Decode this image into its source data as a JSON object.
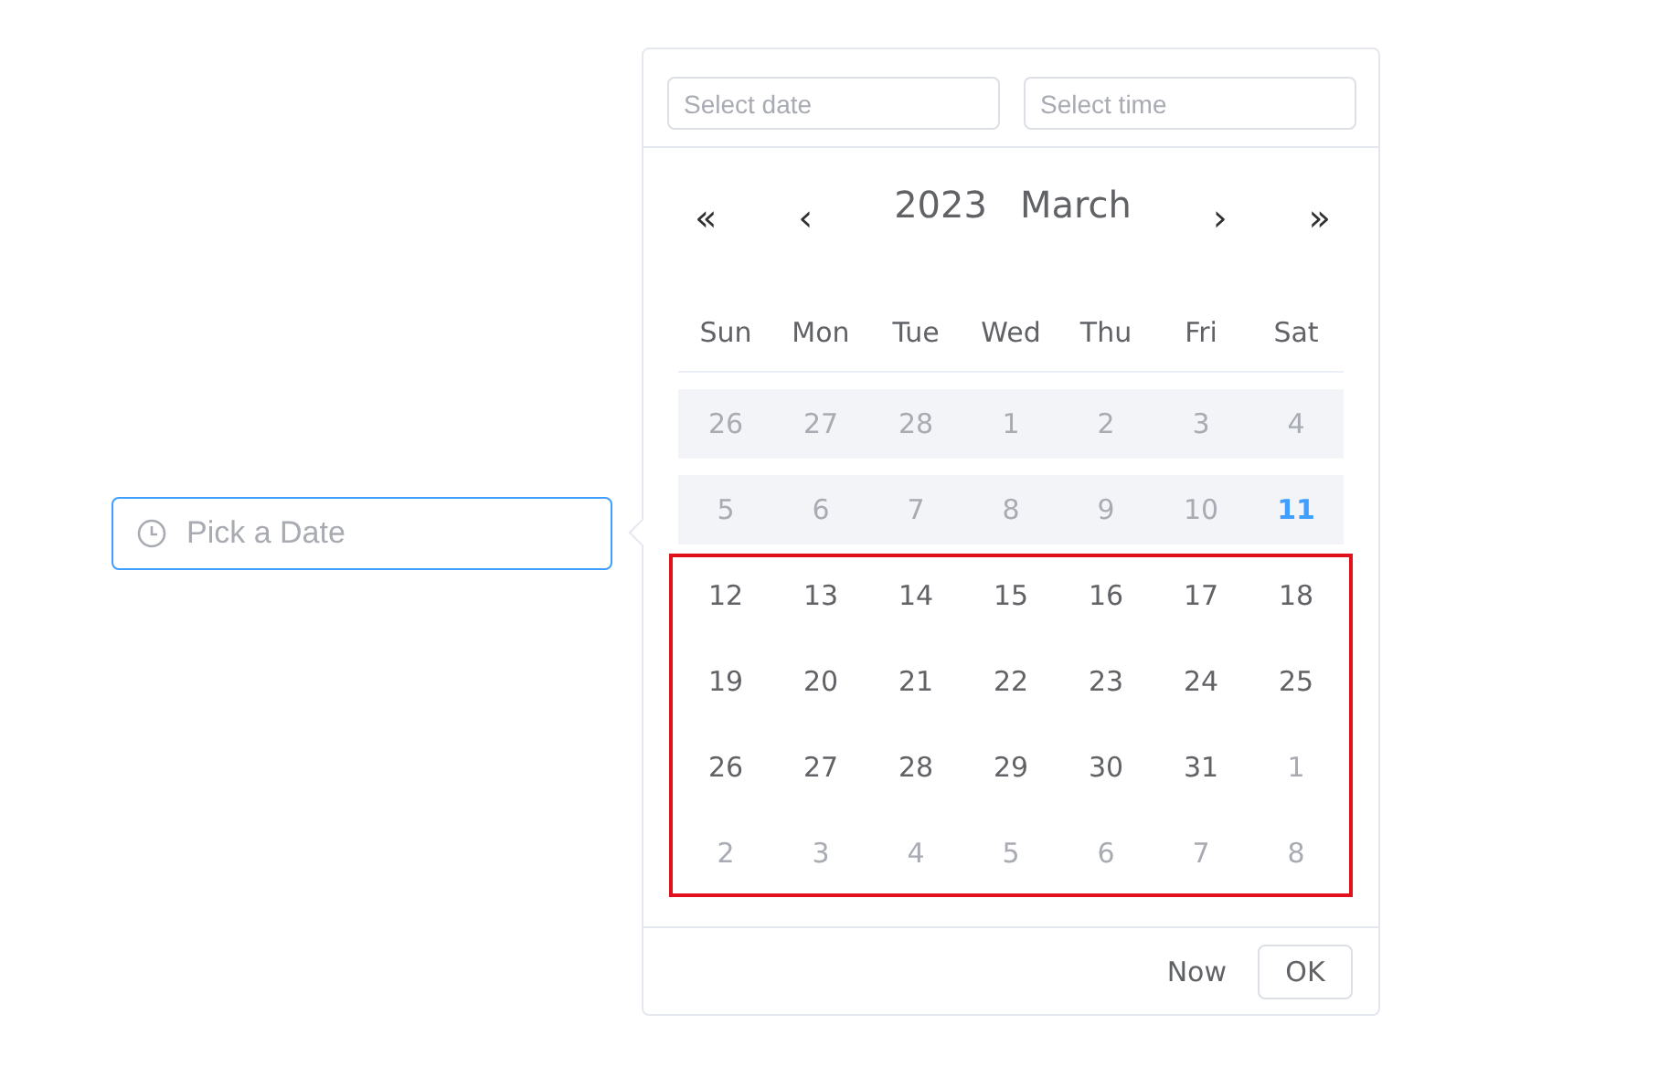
{
  "date_input": {
    "placeholder": "Pick a Date",
    "focused": true
  },
  "picker": {
    "date_field": {
      "placeholder": "Select date"
    },
    "time_field": {
      "placeholder": "Select time"
    },
    "prev_year": "«",
    "prev_month": "‹",
    "year": "2023",
    "month": "March",
    "next_month": "›",
    "next_year": "»",
    "weekdays": [
      "Sun",
      "Mon",
      "Tue",
      "Wed",
      "Thu",
      "Fri",
      "Sat"
    ],
    "weeks": [
      {
        "highlighted": false,
        "days": [
          {
            "label": "26",
            "kind": "muted",
            "disabled": true
          },
          {
            "label": "27",
            "kind": "muted",
            "disabled": true
          },
          {
            "label": "28",
            "kind": "muted",
            "disabled": true
          },
          {
            "label": "1",
            "kind": "current",
            "disabled": true
          },
          {
            "label": "2",
            "kind": "current",
            "disabled": true
          },
          {
            "label": "3",
            "kind": "current",
            "disabled": true
          },
          {
            "label": "4",
            "kind": "current",
            "disabled": true
          }
        ]
      },
      {
        "highlighted": false,
        "days": [
          {
            "label": "5",
            "kind": "current",
            "disabled": true
          },
          {
            "label": "6",
            "kind": "current",
            "disabled": true
          },
          {
            "label": "7",
            "kind": "current",
            "disabled": true
          },
          {
            "label": "8",
            "kind": "current",
            "disabled": true
          },
          {
            "label": "9",
            "kind": "current",
            "disabled": true
          },
          {
            "label": "10",
            "kind": "current",
            "disabled": true
          },
          {
            "label": "11",
            "kind": "today",
            "disabled": true
          }
        ]
      },
      {
        "highlighted": true,
        "days": [
          {
            "label": "12",
            "kind": "current",
            "disabled": false
          },
          {
            "label": "13",
            "kind": "current",
            "disabled": false
          },
          {
            "label": "14",
            "kind": "current",
            "disabled": false
          },
          {
            "label": "15",
            "kind": "current",
            "disabled": false
          },
          {
            "label": "16",
            "kind": "current",
            "disabled": false
          },
          {
            "label": "17",
            "kind": "current",
            "disabled": false
          },
          {
            "label": "18",
            "kind": "current",
            "disabled": false
          }
        ]
      },
      {
        "highlighted": true,
        "days": [
          {
            "label": "19",
            "kind": "current",
            "disabled": false
          },
          {
            "label": "20",
            "kind": "current",
            "disabled": false
          },
          {
            "label": "21",
            "kind": "current",
            "disabled": false
          },
          {
            "label": "22",
            "kind": "current",
            "disabled": false
          },
          {
            "label": "23",
            "kind": "current",
            "disabled": false
          },
          {
            "label": "24",
            "kind": "current",
            "disabled": false
          },
          {
            "label": "25",
            "kind": "current",
            "disabled": false
          }
        ]
      },
      {
        "highlighted": true,
        "days": [
          {
            "label": "26",
            "kind": "current",
            "disabled": false
          },
          {
            "label": "27",
            "kind": "current",
            "disabled": false
          },
          {
            "label": "28",
            "kind": "current",
            "disabled": false
          },
          {
            "label": "29",
            "kind": "current",
            "disabled": false
          },
          {
            "label": "30",
            "kind": "current",
            "disabled": false
          },
          {
            "label": "31",
            "kind": "current",
            "disabled": false
          },
          {
            "label": "1",
            "kind": "muted",
            "disabled": false
          }
        ]
      },
      {
        "highlighted": true,
        "days": [
          {
            "label": "2",
            "kind": "muted",
            "disabled": false
          },
          {
            "label": "3",
            "kind": "muted",
            "disabled": false
          },
          {
            "label": "4",
            "kind": "muted",
            "disabled": false
          },
          {
            "label": "5",
            "kind": "muted",
            "disabled": false
          },
          {
            "label": "6",
            "kind": "muted",
            "disabled": false
          },
          {
            "label": "7",
            "kind": "muted",
            "disabled": false
          },
          {
            "label": "8",
            "kind": "muted",
            "disabled": false
          }
        ]
      }
    ],
    "footer": {
      "now": "Now",
      "ok": "OK"
    }
  }
}
